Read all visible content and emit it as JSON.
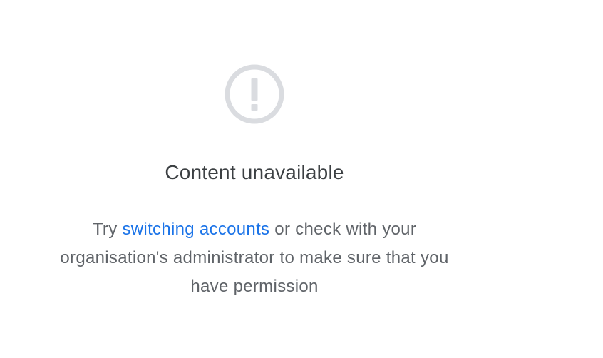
{
  "error": {
    "icon": "exclamation-circle-icon",
    "title": "Content unavailable",
    "message_prefix": "Try ",
    "link_text": "switching accounts",
    "message_suffix": " or check with your organisation's administrator to make sure that you have permission"
  },
  "colors": {
    "icon": "#dadce0",
    "title": "#3c4043",
    "body": "#5f6368",
    "link": "#1a73e8"
  }
}
